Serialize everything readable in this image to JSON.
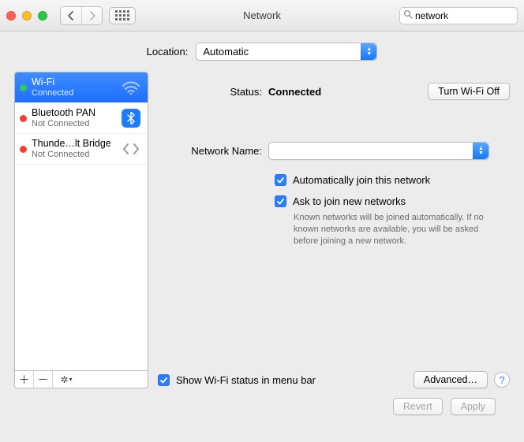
{
  "window": {
    "title": "Network"
  },
  "search": {
    "value": "network"
  },
  "location": {
    "label": "Location:",
    "value": "Automatic"
  },
  "interfaces": [
    {
      "name": "Wi-Fi",
      "sub": "Connected",
      "status": "green",
      "selected": true,
      "icon": "wifi"
    },
    {
      "name": "Bluetooth PAN",
      "sub": "Not Connected",
      "status": "red",
      "selected": false,
      "icon": "bluetooth"
    },
    {
      "name": "Thunde…lt Bridge",
      "sub": "Not Connected",
      "status": "red",
      "selected": false,
      "icon": "thunderbolt"
    }
  ],
  "details": {
    "status_label": "Status:",
    "status_value": "Connected",
    "turn_off_label": "Turn Wi-Fi Off",
    "network_name_label": "Network Name:",
    "network_name_value": "",
    "auto_join_label": "Automatically join this network",
    "ask_join_label": "Ask to join new networks",
    "ask_join_help": "Known networks will be joined automatically. If no known networks are available, you will be asked before joining a new network.",
    "show_status_label": "Show Wi-Fi status in menu bar",
    "advanced_label": "Advanced…"
  },
  "footer": {
    "revert": "Revert",
    "apply": "Apply"
  }
}
